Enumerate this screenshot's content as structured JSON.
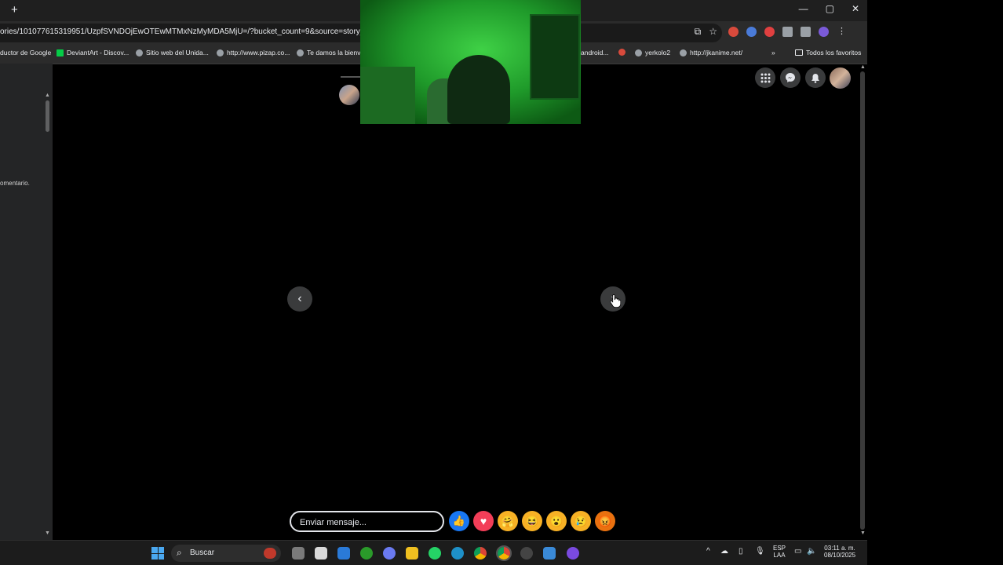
{
  "browser": {
    "new_tab_label": "+",
    "window_controls": [
      "—",
      "▢",
      "✕"
    ],
    "url": "ories/101077615319951/UzpfSVNDOjEwOTEwMTMxNzMyMDA5MjU=/?bucket_count=9&source=story_tray",
    "omnibox_icons": [
      "⧉",
      "☆"
    ],
    "extension_colors": [
      "#d84a3c",
      "#4a7bd8",
      "#e04040",
      "#9aa0a6",
      "#9aa0a6",
      "#7a5ad8",
      "#9aa0a6"
    ],
    "bookmarks": [
      "ductor de Google",
      "DeviantArt - Discov...",
      "Sitio web del Unida...",
      "http://www.pizap.co...",
      "Te damos la bienve",
      "android...",
      "yerkolo2",
      "http://jkanime.net/",
      "»",
      "Todos los favoritos"
    ]
  },
  "page": {
    "left_comment": "omentario.",
    "top_icons": [
      "menu-grid",
      "messenger",
      "notifications"
    ],
    "prev_arrow": "‹",
    "next_arrow": "›",
    "message_placeholder": "Enviar mensaje...",
    "reactions": [
      {
        "name": "like",
        "glyph": "👍",
        "color": "#1877f2"
      },
      {
        "name": "love",
        "glyph": "♥",
        "color": "#f33e58"
      },
      {
        "name": "care",
        "glyph": "🤗",
        "color": "#f7b125"
      },
      {
        "name": "haha",
        "glyph": "😆",
        "color": "#f7b125"
      },
      {
        "name": "wow",
        "glyph": "😮",
        "color": "#f7b125"
      },
      {
        "name": "sad",
        "glyph": "😢",
        "color": "#f7b125"
      },
      {
        "name": "angry",
        "glyph": "😡",
        "color": "#e9710f"
      }
    ]
  },
  "taskbar": {
    "search_label": "Buscar",
    "lang": "ESP",
    "lang_sub": "LAA",
    "time": "03:11 a. m.",
    "date": "08/10/2025"
  }
}
